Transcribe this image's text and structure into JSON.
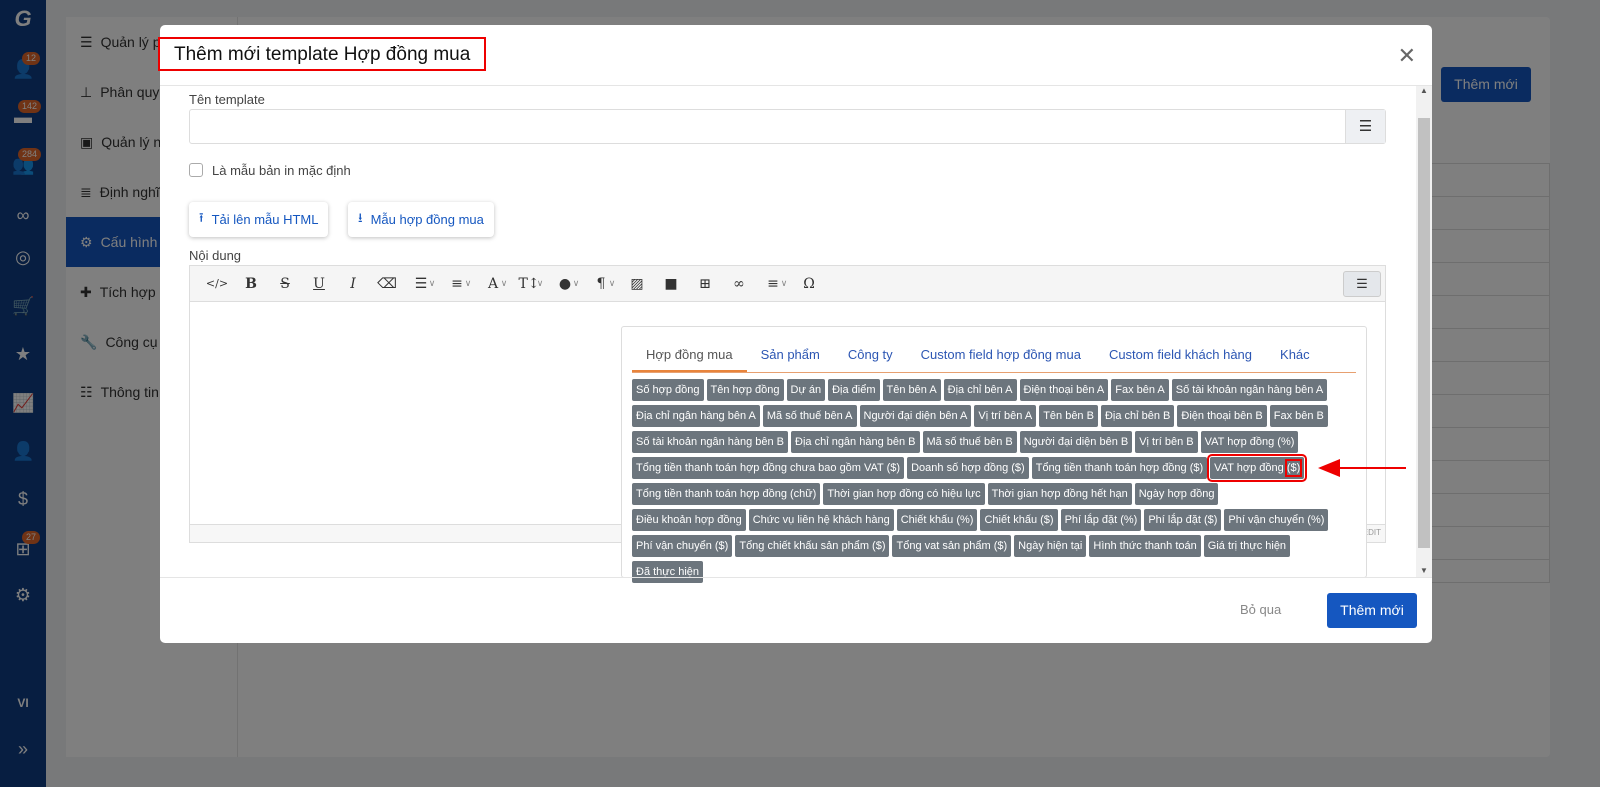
{
  "sidebar": {
    "badges": [
      "12",
      "142",
      "284",
      "27"
    ],
    "lang": "VI"
  },
  "menu": {
    "items": [
      "Quản lý p",
      "Phân quyề",
      "Quản lý n",
      "Định nghĩ",
      "Cấu hình",
      "Tích hợp",
      "Công cụ",
      "Thông tin"
    ],
    "active_index": 4
  },
  "background": {
    "add_button": "Thêm mới"
  },
  "modal": {
    "title": "Thêm mới template Hợp đồng mua",
    "name_label": "Tên template",
    "name_value": "",
    "default_checkbox_label": "Là mẫu bản in mặc định",
    "default_checked": false,
    "upload_button": "Tải lên mẫu HTML",
    "sample_button": "Mẫu hợp đồng mua",
    "content_label": "Nội dung",
    "editor_status": "EDIT",
    "tabs": [
      "Hợp đồng mua",
      "Sản phẩm",
      "Công ty",
      "Custom field hợp đồng mua",
      "Custom field khách hàng",
      "Khác"
    ],
    "active_tab": 0,
    "tags": [
      "Số hợp đồng",
      "Tên hợp đồng",
      "Dự án",
      "Địa điểm",
      "Tên bên A",
      "Địa chỉ bên A",
      "Điện thoại bên A",
      "Fax bên A",
      "Số tài khoản ngân hàng bên A",
      "Địa chỉ ngân hàng bên A",
      "Mã số thuế bên A",
      "Người đại diện bên A",
      "Vị trí bên A",
      "Tên bên B",
      "Địa chỉ bên B",
      "Điện thoại bên B",
      "Fax bên B",
      "Số tài khoản ngân hàng bên B",
      "Địa chỉ ngân hàng bên B",
      "Mã số thuế bên B",
      "Người đại diện bên B",
      "Vị trí bên B",
      "VAT hợp đồng (%)",
      "Tổng tiền thanh toán hợp đồng chưa bao gồm VAT ($)",
      "Doanh số hợp đồng ($)",
      "Tổng tiền thanh toán hợp đồng ($)",
      "VAT hợp đồng ($)",
      "Tổng tiền thanh toán hợp đồng (chữ)",
      "Thời gian hợp đồng có hiệu lực",
      "Thời gian hợp đồng hết hạn",
      "Ngày hợp đồng",
      "Điều khoản hợp đồng",
      "Chức vụ liên hệ khách hàng",
      "Chiết khấu (%)",
      "Chiết khấu ($)",
      "Phí lắp đặt (%)",
      "Phí lắp đặt ($)",
      "Phí vận chuyển (%)",
      "Phí vận chuyển ($)",
      "Tổng chiết khấu sản phẩm ($)",
      "Tổng vat sản phẩm ($)",
      "Ngày hiện tại",
      "Hình thức thanh toán",
      "Giá trị thực hiện",
      "Đã thực hiện"
    ],
    "highlighted_tag": "VAT hợp đồng ($)",
    "cancel_button": "Bỏ qua",
    "submit_button": "Thêm mới"
  },
  "colors": {
    "primary": "#1557c0",
    "tag": "#6c757d",
    "highlight": "#e00000",
    "tab_underline": "#e8843c"
  }
}
